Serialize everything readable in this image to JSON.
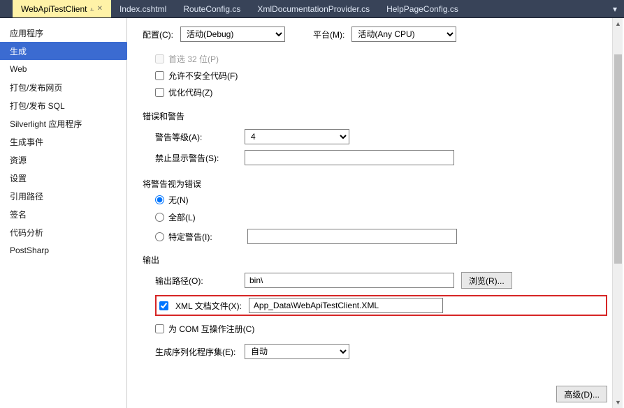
{
  "tabs": {
    "active": "WebApiTestClient",
    "others": [
      "Index.cshtml",
      "RouteConfig.cs",
      "XmlDocumentationProvider.cs",
      "HelpPageConfig.cs"
    ]
  },
  "sidebar": [
    "应用程序",
    "生成",
    "Web",
    "打包/发布网页",
    "打包/发布 SQL",
    "Silverlight 应用程序",
    "生成事件",
    "资源",
    "设置",
    "引用路径",
    "签名",
    "代码分析",
    "PostSharp"
  ],
  "top": {
    "config_label": "配置(C):",
    "config_value": "活动(Debug)",
    "platform_label": "平台(M):",
    "platform_value": "活动(Any CPU)"
  },
  "general": {
    "prefer32": "首选 32 位(P)",
    "unsafe": "允许不安全代码(F)",
    "optimize": "优化代码(Z)"
  },
  "errwarn": {
    "header": "错误和警告",
    "level_label": "警告等级(A):",
    "level_value": "4",
    "suppress_label": "禁止显示警告(S):",
    "suppress_value": ""
  },
  "treat": {
    "header": "将警告视为错误",
    "none": "无(N)",
    "all": "全部(L)",
    "specific": "特定警告(I):",
    "specific_value": ""
  },
  "output": {
    "header": "输出",
    "path_label": "输出路径(O):",
    "path_value": "bin\\",
    "browse": "浏览(R)...",
    "xml_label": "XML 文档文件(X):",
    "xml_value": "App_Data\\WebApiTestClient.XML",
    "com_label": "为 COM 互操作注册(C)",
    "serial_label": "生成序列化程序集(E):",
    "serial_value": "自动",
    "advanced": "高级(D)..."
  }
}
